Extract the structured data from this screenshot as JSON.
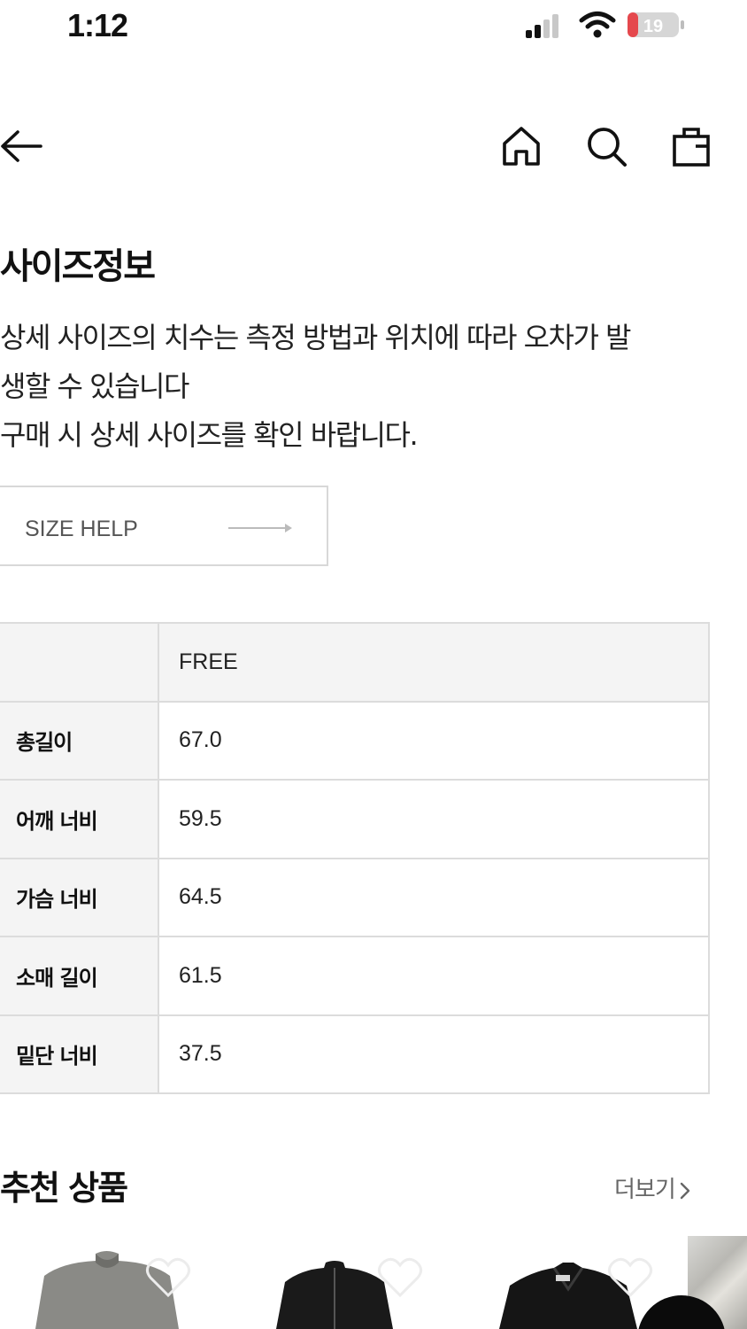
{
  "status_bar": {
    "time": "1:12",
    "battery": "19"
  },
  "nav": {
    "icons": [
      "back-arrow-icon",
      "home-icon",
      "search-icon",
      "shopping-bag-icon"
    ]
  },
  "page": {
    "title": "사이즈정보",
    "description_lines": [
      "상세 사이즈의 치수는 측정 방법과 위치에 따라 오차가 발",
      "생할 수 있습니다",
      "구매 시 상세 사이즈를 확인 바랍니다."
    ],
    "size_help_label": "SIZE HELP"
  },
  "size_table": {
    "header": [
      "",
      "FREE"
    ],
    "rows": [
      {
        "label": "총길이",
        "value": "67.0"
      },
      {
        "label": "어깨 너비",
        "value": "59.5"
      },
      {
        "label": "가슴 너비",
        "value": "64.5"
      },
      {
        "label": "소매 길이",
        "value": "61.5"
      },
      {
        "label": "밑단 너비",
        "value": "37.5"
      }
    ]
  },
  "recommended": {
    "title": "추천 상품",
    "more_label": "더보기",
    "products": [
      {
        "color": "#8a8a86",
        "icon": "heart-icon"
      },
      {
        "color": "#1a1a1a",
        "icon": "heart-icon"
      },
      {
        "color": "#151515",
        "icon": "heart-icon"
      }
    ]
  },
  "colors": {
    "table_border": "#dcdcdc",
    "table_header_bg": "#f4f4f4",
    "battery_low": "#e5484d"
  }
}
